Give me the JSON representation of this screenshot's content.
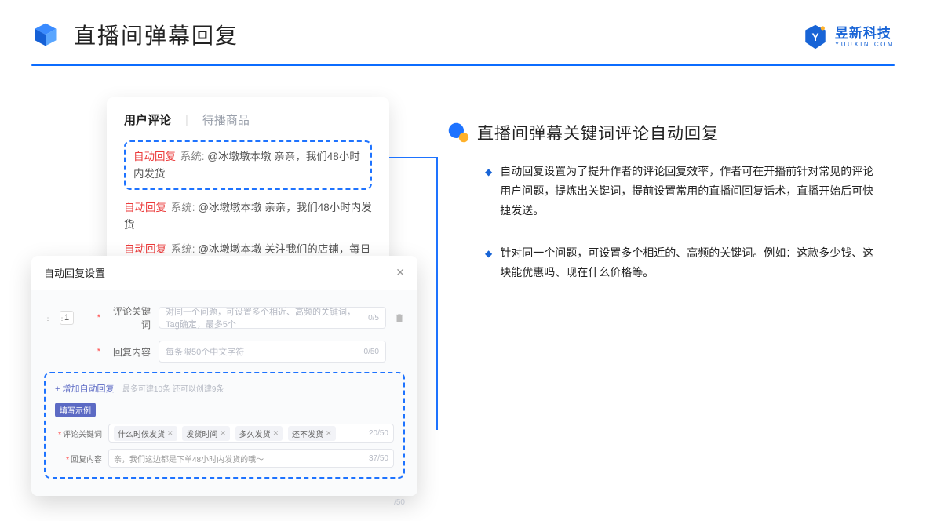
{
  "header": {
    "title": "直播间弹幕回复",
    "brand_cn": "昱新科技",
    "brand_en": "YUUXIN.COM"
  },
  "comments": {
    "tab_active": "用户评论",
    "tab_inactive": "待播商品",
    "rows": [
      {
        "auto": "自动回复",
        "sys": "系统:",
        "text": "@冰墩墩本墩 亲亲，我们48小时内发货"
      },
      {
        "auto": "自动回复",
        "sys": "系统:",
        "text": "@冰墩墩本墩 亲亲，我们48小时内发货"
      },
      {
        "auto": "自动回复",
        "sys": "系统:",
        "text": "@冰墩墩本墩 关注我们的店铺，每日都有热门推荐呦～"
      }
    ]
  },
  "settings": {
    "title": "自动回复设置",
    "idx": "1",
    "keyword_label": "评论关键词",
    "keyword_placeholder": "对同一个问题，可设置多个相近、高频的关键词，Tag确定，最多5个",
    "keyword_count": "0/5",
    "content_label": "回复内容",
    "content_placeholder": "每条限50个中文字符",
    "content_count": "0/50",
    "add_link": "增加自动回复",
    "add_hint": "最多可建10条 还可以创建9条",
    "example_badge": "填写示例",
    "example_kw_label": "评论关键词",
    "example_tags": [
      "什么时候发货",
      "发货时间",
      "多久发货",
      "还不发货"
    ],
    "example_kw_count": "20/50",
    "example_content_label": "回复内容",
    "example_content_value": "亲，我们这边都是下单48小时内发货的哦～",
    "example_content_count": "37/50",
    "under_count": "/50"
  },
  "right": {
    "title": "直播间弹幕关键词评论自动回复",
    "bullets": [
      "自动回复设置为了提升作者的评论回复效率，作者可在开播前针对常见的评论用户问题，提炼出关键词，提前设置常用的直播间回复话术，直播开始后可快捷发送。",
      "针对同一个问题，可设置多个相近的、高频的关键词。例如：这款多少钱、这块能优惠吗、现在什么价格等。"
    ]
  }
}
